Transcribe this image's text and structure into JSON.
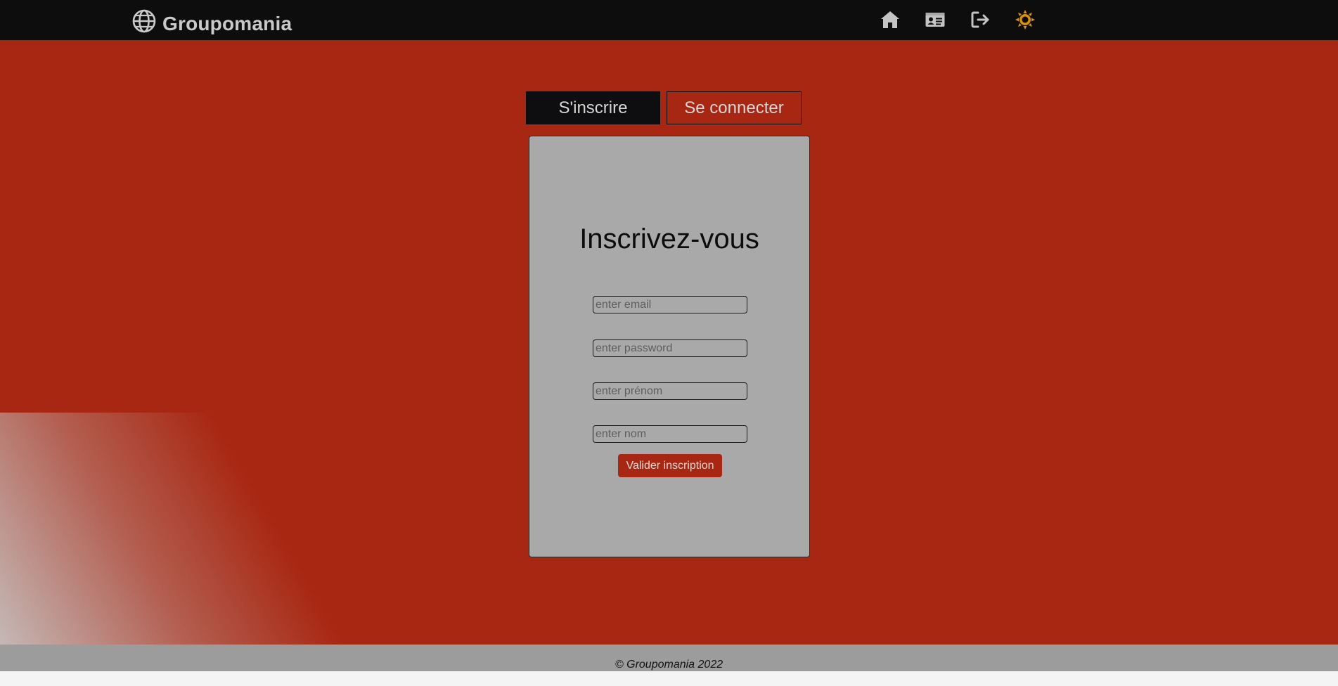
{
  "navbar": {
    "brand_name": "Groupomania",
    "brand_icon": "globe-icon",
    "icons": [
      "home-icon",
      "profile-card-icon",
      "logout-icon",
      "theme-sun-icon"
    ],
    "sun_color": "#d4920e"
  },
  "tabs": {
    "signup_label": "S'inscrire",
    "login_label": "Se connecter"
  },
  "form": {
    "title": "Inscrivez-vous",
    "email_placeholder": "enter email",
    "password_placeholder": "enter password",
    "firstname_placeholder": "enter prénom",
    "lastname_placeholder": "enter nom",
    "submit_label": "Valider inscription"
  },
  "footer": {
    "text": "© Groupomania 2022"
  },
  "colors": {
    "background": "#a82712",
    "navbar": "#0d0d0e",
    "card": "#a9a9a9"
  }
}
